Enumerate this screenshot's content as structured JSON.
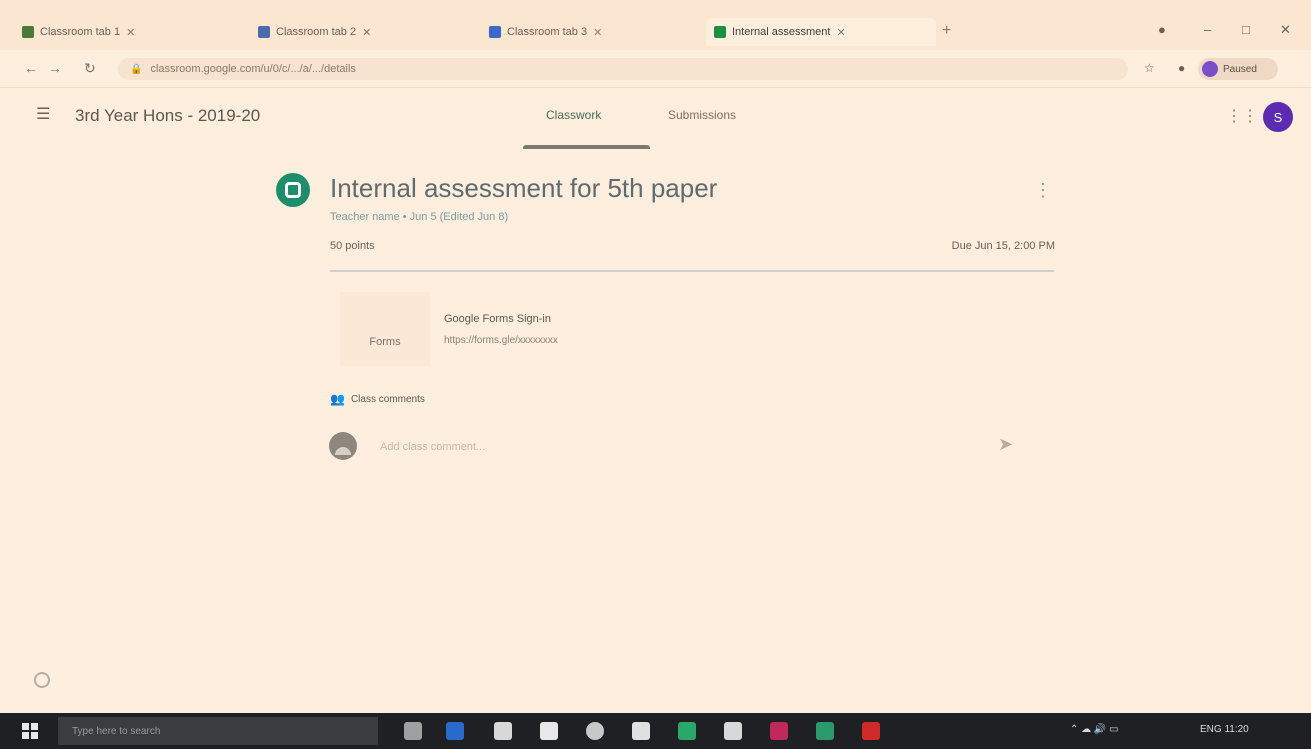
{
  "browser": {
    "tabs": [
      {
        "title": "Classroom tab 1",
        "favicon_color": "#4a7a3a"
      },
      {
        "title": "Classroom tab 2",
        "favicon_color": "#4a6aaa"
      },
      {
        "title": "Classroom tab 3",
        "favicon_color": "#3b6ac8"
      },
      {
        "title": "Internal assessment",
        "favicon_color": "#1e8e3e"
      }
    ],
    "new_tab": "+",
    "minimize": "–",
    "maximize": "□",
    "close": "✕",
    "url": "classroom.google.com/u/0/c/.../a/.../details",
    "profile_label": "Paused"
  },
  "classroom": {
    "menu_icon": "☰",
    "class_name": "3rd Year Hons - 2019-20",
    "tabs": [
      {
        "label": "Classwork",
        "active": true
      },
      {
        "label": "Submissions",
        "active": false
      }
    ],
    "apps_icon": "⋮⋮⋮",
    "avatar_letter": "S"
  },
  "assignment": {
    "title": "Internal assessment for 5th paper",
    "meta": "Teacher name • Jun 5 (Edited Jun 8)",
    "points": "50 points",
    "due": "Due Jun 15, 2:00 PM",
    "more_icon": "⋮",
    "attachment": {
      "thumb_label": "Forms",
      "title": "Google Forms Sign-in",
      "url": "https://forms.gle/xxxxxxxx"
    },
    "class_comments_label": "Class comments",
    "comment_placeholder": "Add class comment...",
    "send_icon": "➤"
  },
  "taskbar": {
    "search_placeholder": "Type here to search",
    "tray_text": "ENG 11:20"
  },
  "colors": {
    "accent": "#1e8e6a",
    "avatar": "#5c2bb0",
    "background": "#fdeedd"
  }
}
